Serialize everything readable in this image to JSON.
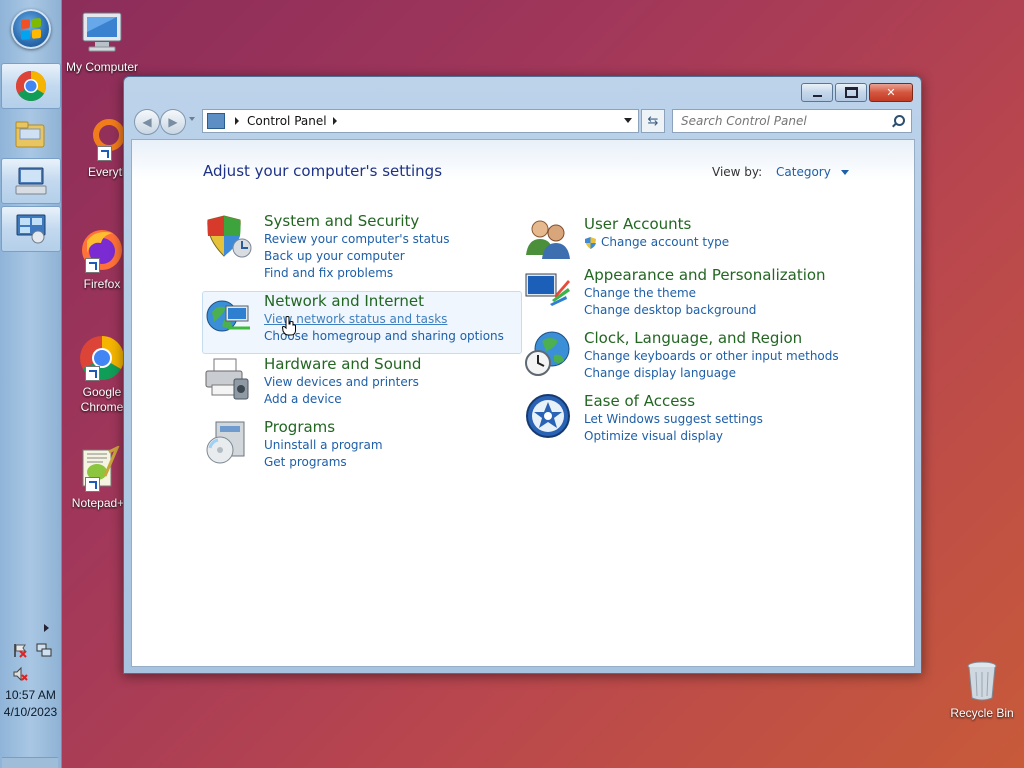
{
  "desktop": {
    "icons": [
      {
        "label": "My Computer"
      },
      {
        "label": "Everythin"
      },
      {
        "label": "Firefox"
      },
      {
        "label": "Google Chrome"
      },
      {
        "label": "Notepad+"
      }
    ],
    "recycle_bin": {
      "label": "Recycle Bin"
    }
  },
  "taskbar": {
    "clock_time": "10:57 AM",
    "clock_date": "4/10/2023"
  },
  "window": {
    "address": {
      "crumb": "Control Panel"
    },
    "search": {
      "placeholder": "Search Control Panel"
    },
    "heading": "Adjust your computer's settings",
    "view_by": {
      "label": "View by:",
      "value": "Category"
    },
    "left_categories": [
      {
        "title": "System and Security",
        "links": [
          "Review your computer's status",
          "Back up your computer",
          "Find and fix problems"
        ]
      },
      {
        "title": "Network and Internet",
        "links": [
          "View network status and tasks",
          "Choose homegroup and sharing options"
        ]
      },
      {
        "title": "Hardware and Sound",
        "links": [
          "View devices and printers",
          "Add a device"
        ]
      },
      {
        "title": "Programs",
        "links": [
          "Uninstall a program",
          "Get programs"
        ]
      }
    ],
    "right_categories": [
      {
        "title": "User Accounts",
        "links": [
          "Change account type"
        ]
      },
      {
        "title": "Appearance and Personalization",
        "links": [
          "Change the theme",
          "Change desktop background"
        ]
      },
      {
        "title": "Clock, Language, and Region",
        "links": [
          "Change keyboards or other input methods",
          "Change display language"
        ]
      },
      {
        "title": "Ease of Access",
        "links": [
          "Let Windows suggest settings",
          "Optimize visual display"
        ]
      }
    ]
  }
}
